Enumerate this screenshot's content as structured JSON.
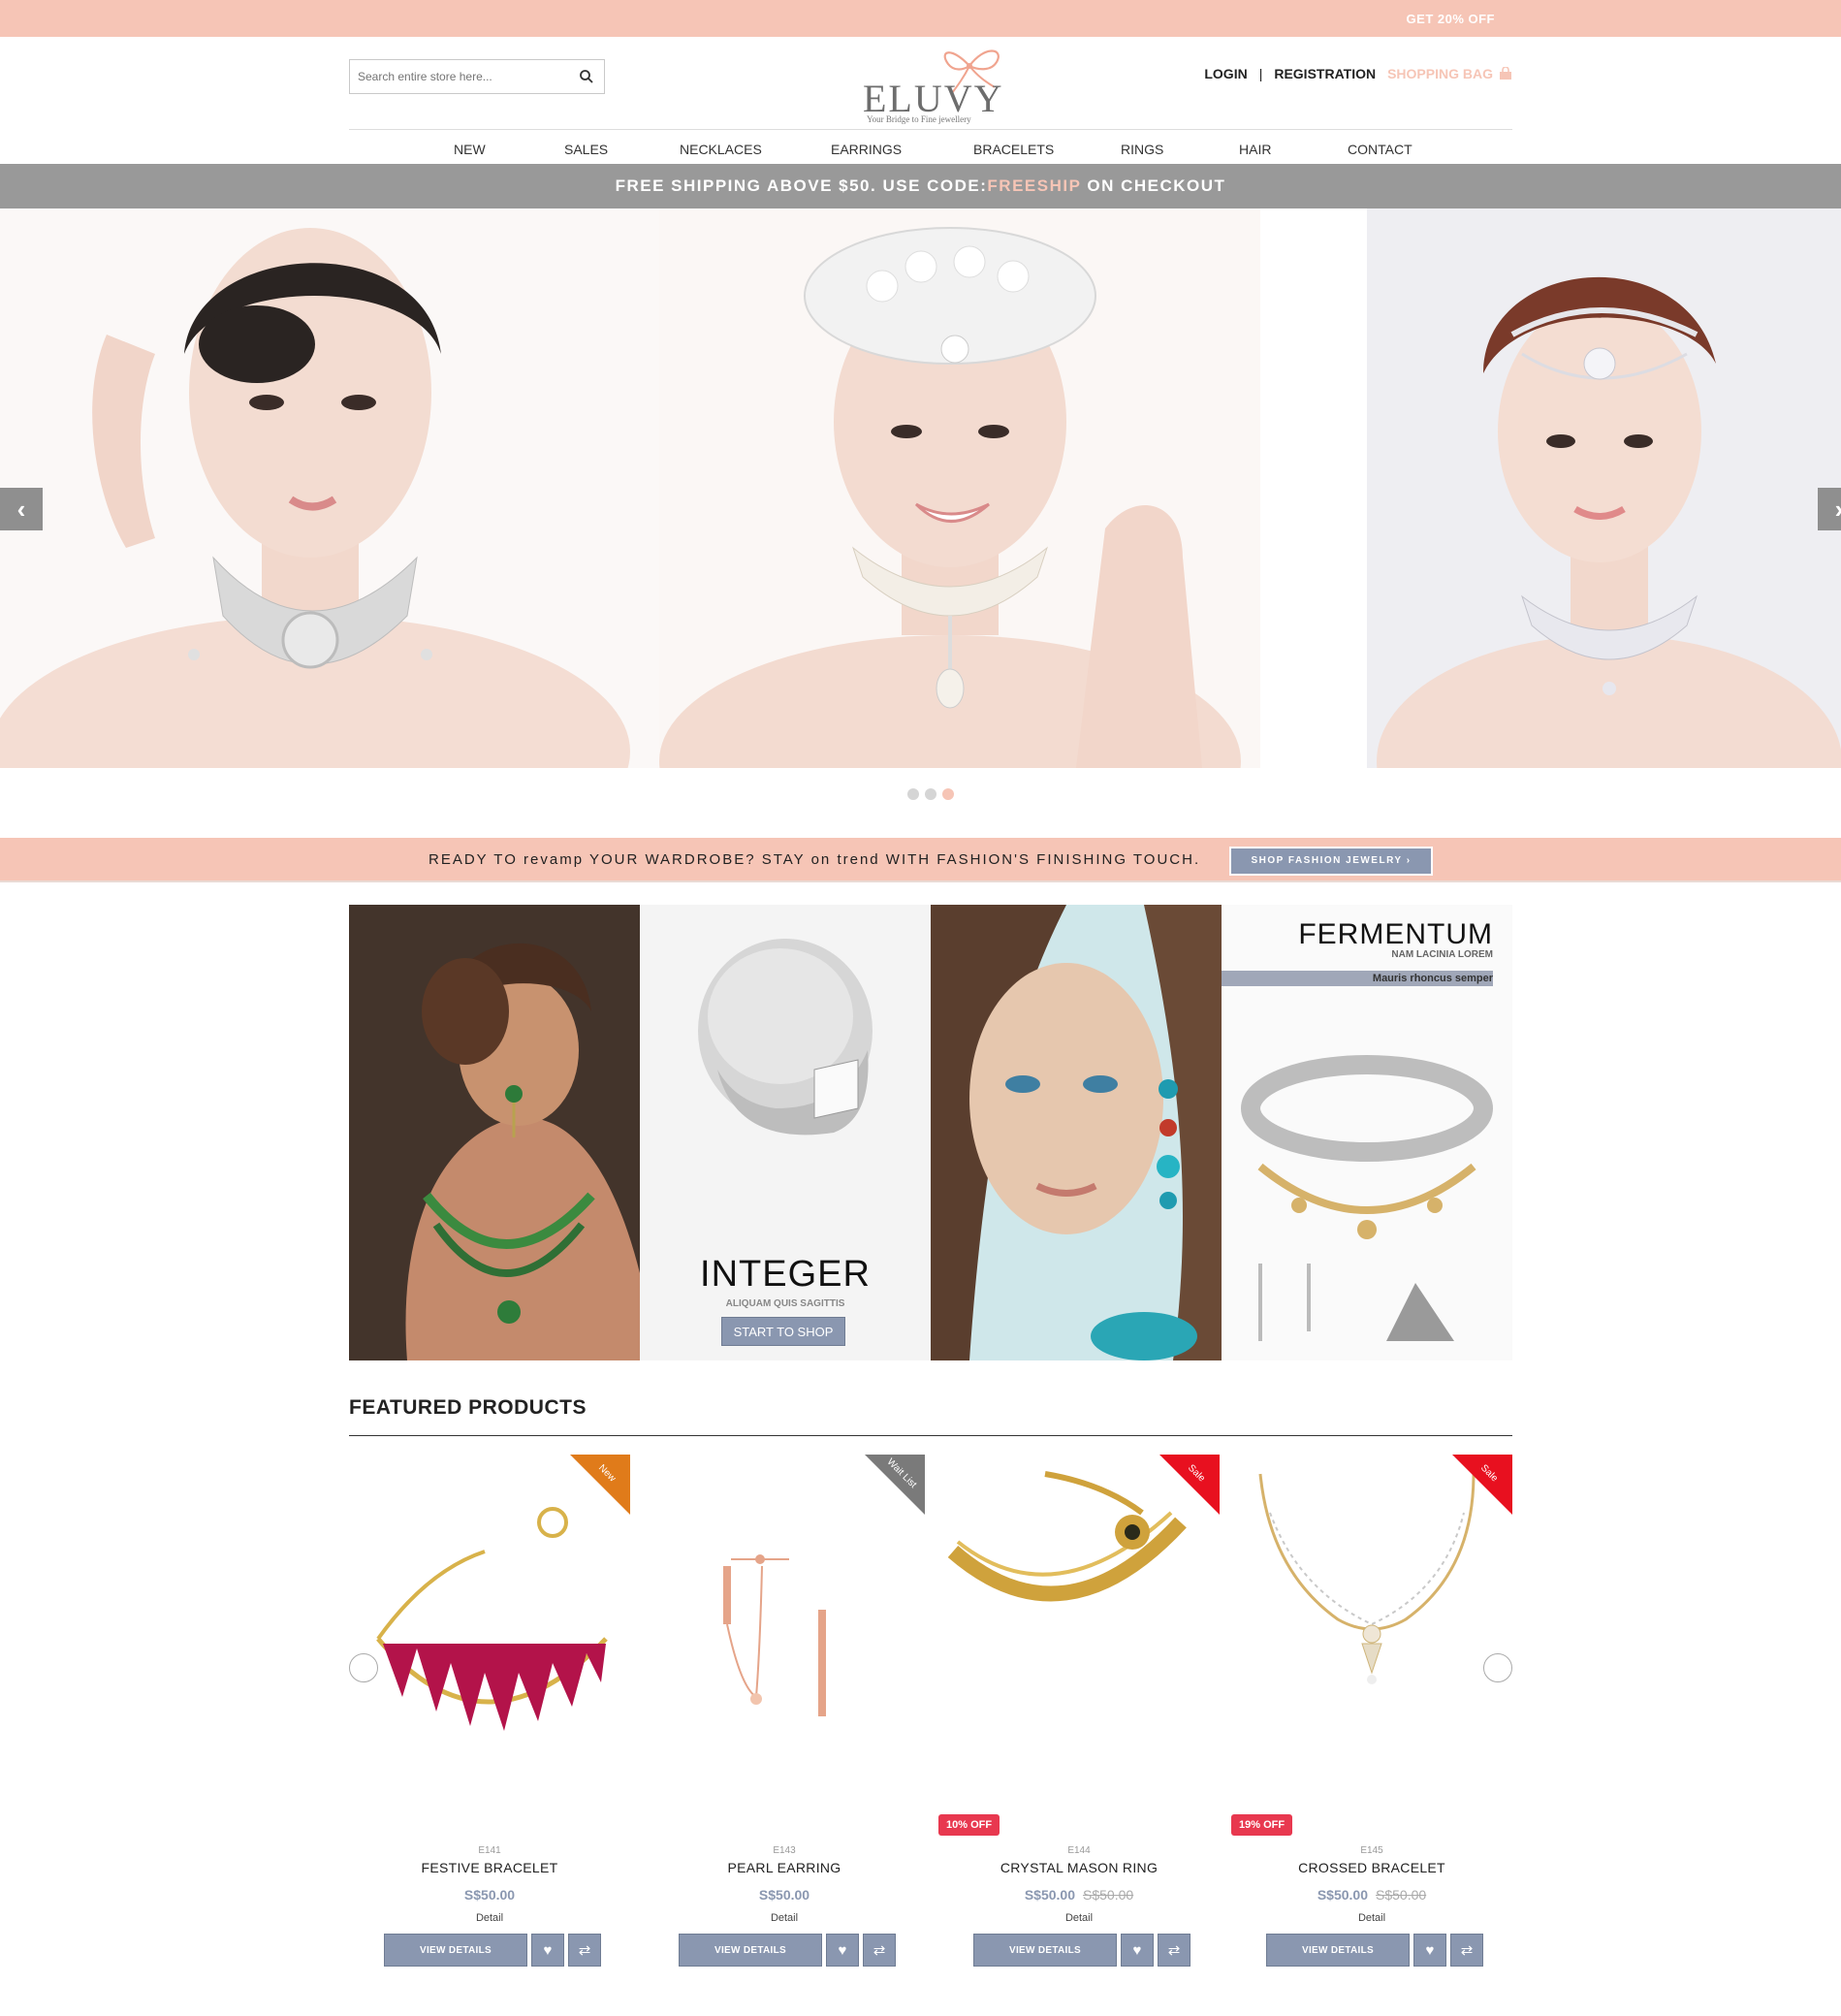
{
  "topbar": {
    "promo": "GET 20% OFF"
  },
  "header": {
    "search_placeholder": "Search entire store here...",
    "logo_text": "ELUVY",
    "logo_tagline": "Your Bridge to Fine jewellery",
    "login": "LOGIN",
    "separator": "|",
    "registration": "REGISTRATION",
    "shopping_bag": "SHOPPING BAG"
  },
  "nav": [
    "NEW",
    "SALES",
    "NECKLACES",
    "EARRINGS",
    "BRACELETS",
    "RINGS",
    "HAIR",
    "CONTACT"
  ],
  "shipping": {
    "prefix": "FREE SHIPPING ABOVE $50. USE CODE:",
    "code": "FREESHIP",
    "suffix": " ON CHECKOUT"
  },
  "slider": {
    "dot_count": 3,
    "active_dot": 2
  },
  "ready_banner": {
    "text": "READY TO revamp YOUR WARDROBE? STAY on trend WITH FASHION'S FINISHING TOUCH.",
    "button": "SHOP FASHION JEWELRY ›"
  },
  "promo_tiles": {
    "integer": {
      "title": "INTEGER",
      "subtitle": "ALIQUAM QUIS SAGITTIS",
      "button": "START TO SHOP"
    },
    "fermentum": {
      "title": "FERMENTUM",
      "subtitle": "NAM LACINIA LOREM",
      "bar": "Mauris rhoncus semper"
    }
  },
  "featured": {
    "title": "FEATURED PRODUCTS",
    "products": [
      {
        "sku": "E141",
        "name": "FESTIVE BRACELET",
        "price": "S$50.00",
        "old_price": "",
        "badge": "",
        "ribbon": "New",
        "ribbon_color": "#e07b1a",
        "detail": "Detail",
        "button": "VIEW DETAILS"
      },
      {
        "sku": "E143",
        "name": "PEARL EARRING",
        "price": "S$50.00",
        "old_price": "",
        "badge": "",
        "ribbon": "Wait List",
        "ribbon_color": "#7a7a7a",
        "detail": "Detail",
        "button": "VIEW DETAILS"
      },
      {
        "sku": "E144",
        "name": "CRYSTAL MASON RING",
        "price": "S$50.00",
        "old_price": "S$50.00",
        "badge": "10% OFF",
        "ribbon": "Sale",
        "ribbon_color": "#e8101f",
        "detail": "Detail",
        "button": "VIEW DETAILS"
      },
      {
        "sku": "E145",
        "name": "CROSSED BRACELET",
        "price": "S$50.00",
        "old_price": "S$50.00",
        "badge": "19% OFF",
        "ribbon": "Sale",
        "ribbon_color": "#e8101f",
        "detail": "Detail",
        "button": "VIEW DETAILS"
      }
    ]
  },
  "colors": {
    "accent_pink": "#f6c5b6",
    "slate": "#8a97b0",
    "gray_bar": "#999999",
    "sale_red": "#e8384f"
  }
}
